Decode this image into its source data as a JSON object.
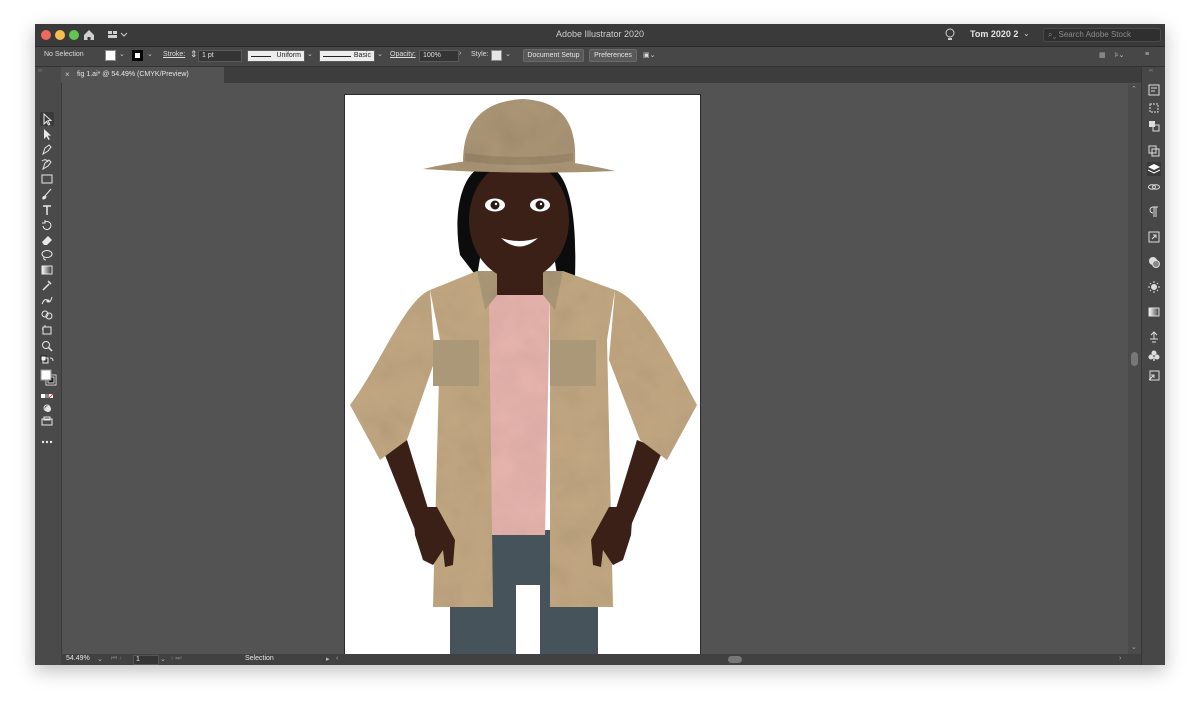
{
  "window": {
    "app_title": "Adobe Illustrator 2020",
    "workspace_name": "Tom 2020 2",
    "search_placeholder": "Search Adobe Stock",
    "icons": {
      "home": "home-icon",
      "workspace_switcher": "workspace-switcher-icon",
      "lightbulb": "lightbulb-icon",
      "search": "search-icon"
    }
  },
  "control_bar": {
    "selection_status": "No Selection",
    "stroke_label": "Stroke:",
    "stroke_weight": "1 pt",
    "variable_width_profile": "Uniform",
    "brush_definition": "Basic",
    "opacity_label": "Opacity:",
    "opacity_value": "100%",
    "style_label": "Style:",
    "document_setup_button": "Document Setup",
    "preferences_button": "Preferences",
    "fill_color": "#ffffff",
    "stroke_color": "#000000"
  },
  "document_tab": {
    "close_glyph": "×",
    "title": "fig 1.ai* @ 54.49% (CMYK/Preview)"
  },
  "status_bar": {
    "zoom": "54.49%",
    "artboard_number": "1",
    "current_tool": "Selection"
  },
  "tools": [
    {
      "name": "selection-tool-icon"
    },
    {
      "name": "direct-selection-tool-icon"
    },
    {
      "name": "pen-tool-icon"
    },
    {
      "name": "curvature-tool-icon"
    },
    {
      "name": "rectangle-tool-icon"
    },
    {
      "name": "paintbrush-tool-icon"
    },
    {
      "name": "type-tool-icon"
    },
    {
      "name": "rotate-tool-icon"
    },
    {
      "name": "eraser-tool-icon"
    },
    {
      "name": "lasso-tool-icon"
    },
    {
      "name": "gradient-tool-icon"
    },
    {
      "name": "eyedropper-tool-icon"
    },
    {
      "name": "puppet-warp-tool-icon"
    },
    {
      "name": "shape-builder-tool-icon"
    },
    {
      "name": "artboard-tool-icon"
    },
    {
      "name": "zoom-tool-icon"
    }
  ],
  "right_panel_icons": [
    "properties-panel-icon",
    "transform-panel-icon",
    "align-panel-icon",
    "pathfinder-panel-icon",
    "layers-panel-icon",
    "links-panel-icon",
    "paragraph-panel-icon",
    "export-panel-icon",
    "color-panel-icon",
    "appearance-panel-icon",
    "gradient-panel-icon",
    "brushes-panel-icon",
    "symbols-panel-icon",
    "asset-export-panel-icon"
  ],
  "colors": {
    "ui_dark": "#535353",
    "artboard": "#ffffff",
    "coat": "#c2a882",
    "coat_pocket": "#ab9878",
    "shirt": "#e6b4ad",
    "skin": "#3b2018",
    "hat": "#ab9676",
    "jeans": "#46535b",
    "hair": "#0c0c0c"
  }
}
